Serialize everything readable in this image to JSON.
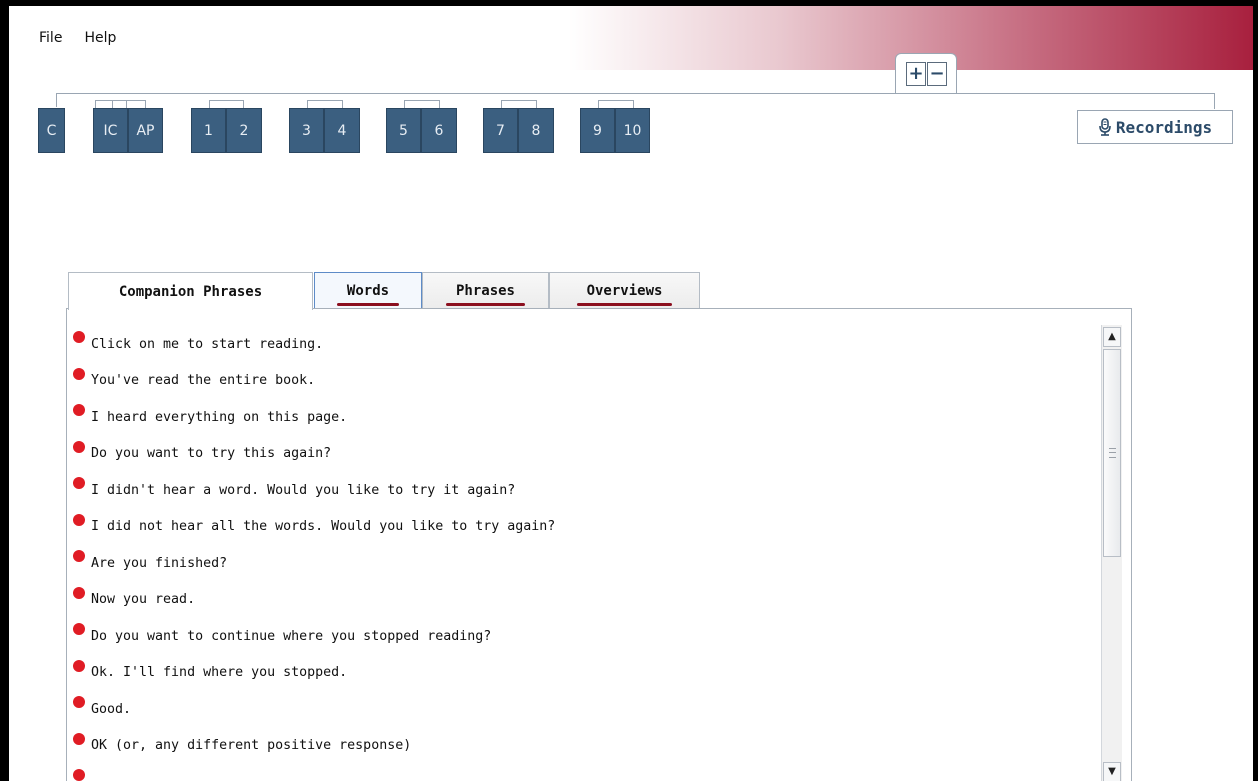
{
  "menu": {
    "file": "File",
    "help": "Help"
  },
  "zoom": {
    "plus": "+",
    "minus": "−"
  },
  "pages": [
    {
      "label": "C"
    },
    {
      "label": "IC"
    },
    {
      "label": "AP"
    },
    {
      "label": "1"
    },
    {
      "label": "2"
    },
    {
      "label": "3"
    },
    {
      "label": "4"
    },
    {
      "label": "5"
    },
    {
      "label": "6"
    },
    {
      "label": "7"
    },
    {
      "label": "8"
    },
    {
      "label": "9"
    },
    {
      "label": "10"
    }
  ],
  "recordings": {
    "label": "Recordings",
    "icon": "microphone-icon"
  },
  "tabs": [
    {
      "label": "Companion Phrases"
    },
    {
      "label": "Words"
    },
    {
      "label": "Phrases"
    },
    {
      "label": "Overviews"
    }
  ],
  "phrases": [
    "Click on me to start reading.",
    "You've read the entire book.",
    "I heard everything on this page.",
    "Do you want to try this again?",
    "I didn't hear a word.  Would you like to try it again?",
    "I did not hear all the words.  Would you like to try again?",
    "Are you finished?",
    "Now you read.",
    "Do you want to continue where you stopped reading?",
    "Ok.  I'll find where you stopped.",
    "Good.",
    "OK (or, any different positive response)"
  ],
  "colors": {
    "bullet": "#e01c24",
    "page_button": "#3b5f80",
    "tab_underline": "#8b0f1f",
    "header_accent": "#a8203e"
  }
}
